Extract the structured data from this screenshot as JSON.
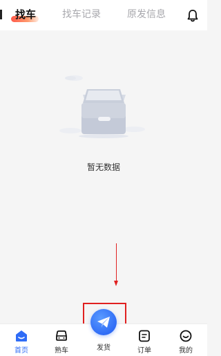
{
  "header": {
    "tabs": [
      {
        "label": "找车",
        "active": true
      },
      {
        "label": "找车记录",
        "active": false
      },
      {
        "label": "原发信息",
        "active": false
      }
    ],
    "bell_icon": "bell-icon"
  },
  "empty_state": {
    "icon": "empty-box-icon",
    "text": "暂无数据"
  },
  "bottom_nav": {
    "items": [
      {
        "label": "首页",
        "icon": "home-icon",
        "active": true
      },
      {
        "label": "熟车",
        "icon": "car-icon",
        "active": false
      },
      {
        "label": "发货",
        "icon": "paper-plane-icon",
        "active": false
      },
      {
        "label": "订单",
        "icon": "order-icon",
        "active": false
      },
      {
        "label": "我的",
        "icon": "smile-icon",
        "active": false
      }
    ]
  },
  "colors": {
    "accent": "#2f6cf6",
    "tab_underline": "#ff5a4a",
    "annotation": "#e02020"
  }
}
